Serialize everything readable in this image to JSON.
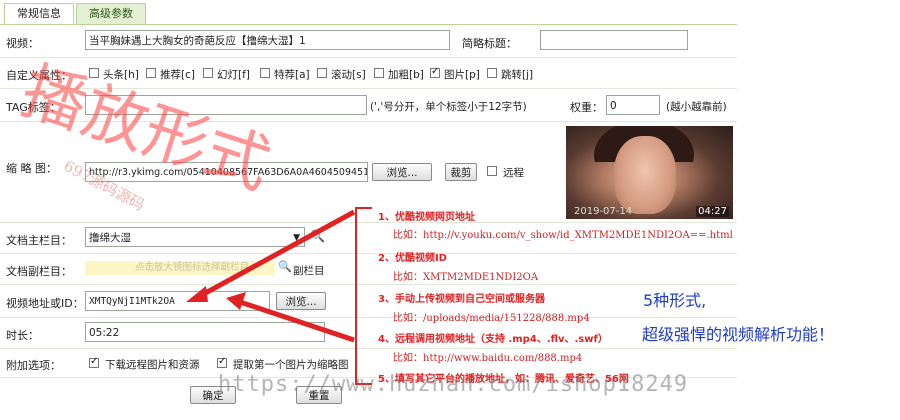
{
  "tabs": [
    {
      "label": "常规信息"
    },
    {
      "label": "高级参数"
    }
  ],
  "fields": {
    "video": {
      "label": "视频：",
      "value": "当平胸妹遇上大胸女的奇葩反应【撸绵大湿】1"
    },
    "short_title": {
      "label": "简略标题：",
      "value": ""
    },
    "custom_attr": {
      "label": "自定义属性：",
      "options": [
        {
          "label": "头条[h]",
          "checked": false
        },
        {
          "label": "推荐[c]",
          "checked": false
        },
        {
          "label": "幻灯[f]",
          "checked": false
        },
        {
          "label": "特荐[a]",
          "checked": false
        },
        {
          "label": "滚动[s]",
          "checked": false
        },
        {
          "label": "加粗[b]",
          "checked": false
        },
        {
          "label": "图片[p]",
          "checked": true
        },
        {
          "label": "跳转[j]",
          "checked": false
        }
      ]
    },
    "tag": {
      "label": "TAG标签：",
      "value": "",
      "hint": "(','号分开，单个标签小于12字节)"
    },
    "weight": {
      "label": "权重：",
      "value": "0",
      "hint": "(越小越靠前)"
    },
    "thumbnail": {
      "label": "缩 略 图：",
      "value": "http://r3.ykimg.com/05410408567FA63D6A0A4604509451",
      "browse": "浏览...",
      "crop": "裁剪",
      "remote": "远程",
      "preview": {
        "date": "2019-07-14",
        "duration": "04:27"
      }
    },
    "main_column": {
      "label": "文档主栏目：",
      "value": "撸绵大湿"
    },
    "sub_column": {
      "label": "文档副栏目：",
      "placeholder": "点击放大镜图标选择副栏目",
      "sub_label": "副栏目"
    },
    "video_url": {
      "label": "视频地址或ID：",
      "value": "XMTQyNjI1MTk2OA",
      "browse": "浏览..."
    },
    "duration": {
      "label": "时长：",
      "value": "05:22"
    },
    "extra": {
      "label": "附加选项：",
      "opt1": "下载远程图片和资源",
      "opt2": "提取第一个图片为缩略图"
    },
    "buttons": {
      "ok": "确定",
      "reset": "重置"
    }
  },
  "annotations": {
    "items": [
      {
        "title": "1、优酷视频网页地址",
        "example": "比如：http://v.youku.com/v_show/id_XMTM2MDE1NDI2OA==.html"
      },
      {
        "title": "2、优酷视频ID",
        "example": "比如：XMTM2MDE1NDI2OA"
      },
      {
        "title": "3、手动上传视频到自己空间或服务器",
        "example": "比如：/uploads/media/151228/888.mp4"
      },
      {
        "title": "4、远程调用视频地址（支持 .mp4、.flv、.swf）",
        "example": "比如：http://www.baidu.com/888.mp4"
      },
      {
        "title": "5、填写其它平台的播放地址，如：腾讯、爱奇艺、56网",
        "example": ""
      }
    ],
    "summary1": "5种形式,",
    "summary2": "超级强悍的视频解析功能！",
    "accent": "#e02222",
    "blue": "#1e3cc8"
  },
  "watermarks": {
    "big": "播放形式",
    "small": "697源码源码",
    "url": "https://www.huzhan.com/ishop18249"
  }
}
